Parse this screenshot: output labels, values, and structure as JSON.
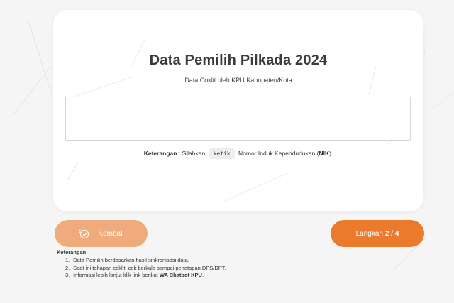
{
  "card": {
    "title": "Data Pemilih Pilkada 2024",
    "subtitle": "Data Coklit oleh KPU Kabupaten/Kota",
    "input_value": "",
    "input_placeholder": "",
    "note": {
      "label": "Keterangan",
      "sep": " : Silahkan",
      "keyword": "ketik",
      "text_before": " Nomor Induk Kependudukan (",
      "nik": "NIK",
      "text_after": ")."
    }
  },
  "nav": {
    "back_label": "Kembali",
    "back_icon": "cursor-click-icon",
    "step_prefix": "Langkah",
    "step_value": "2 / 4"
  },
  "info": {
    "title": "Keterangan",
    "items": [
      {
        "num": "1.",
        "text": "Data Pemilih berdasarkan hasil sinkronisasi data."
      },
      {
        "num": "2.",
        "text": "Saat ini tahapan coklit, cek berkala sampai penetapan DPS/DPT."
      },
      {
        "num": "3.",
        "text": "Informasi lebih lanjut klik link berikut ",
        "bold": "WA Chatbot KPU",
        "tail": "."
      }
    ]
  },
  "colors": {
    "accent": "#ec7a2c",
    "accent_light": "#f0ab7c",
    "background": "#f5f5f5"
  }
}
